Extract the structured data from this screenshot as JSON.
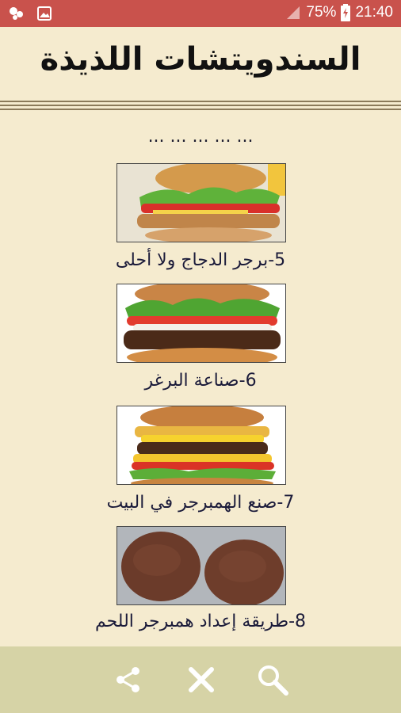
{
  "status_bar": {
    "battery_percent": "75%",
    "time": "21:40",
    "icons": [
      "notification-icon",
      "image-icon",
      "signal-icon",
      "battery-icon"
    ]
  },
  "header": {
    "title": "السندويتشات اللذيذة"
  },
  "list": {
    "partial_item": "... ... ... ... ...",
    "items": [
      {
        "label": "5-برجر الدجاج ولا أحلى",
        "image": "chicken-burger"
      },
      {
        "label": "6-صناعة البرغر",
        "image": "beef-burger"
      },
      {
        "label": "7-صنع الهمبرجر في البيت",
        "image": "double-burger"
      },
      {
        "label": "8-طريقة إعداد همبرجر اللحم",
        "image": "raw-patties"
      }
    ]
  },
  "bottom_bar": {
    "buttons": [
      "share-icon",
      "close-icon",
      "search-icon"
    ]
  },
  "colors": {
    "status_bar": "#c9524c",
    "background": "#f5ebcf",
    "bottom_bar": "#d6d3a6",
    "text": "#1b1b3a"
  }
}
